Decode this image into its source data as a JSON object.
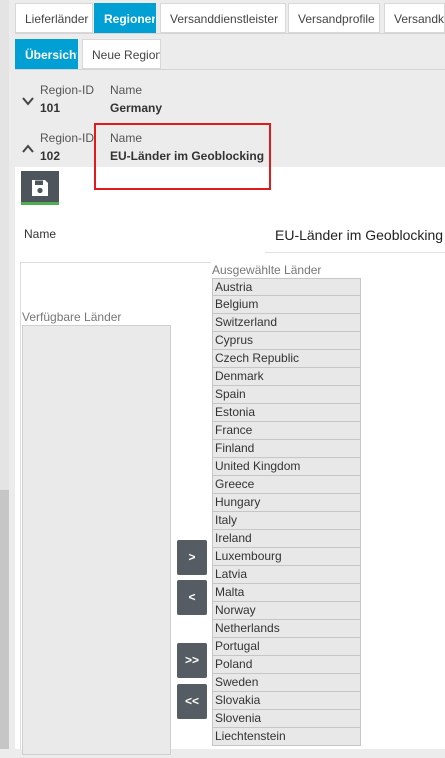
{
  "tabs_top": [
    {
      "label": "Lieferländer"
    },
    {
      "label": "Regionen",
      "active": true
    },
    {
      "label": "Versanddienstleister"
    },
    {
      "label": "Versandprofile"
    },
    {
      "label": "Versandkoste"
    }
  ],
  "tabs_sub": [
    {
      "label": "Übersicht",
      "active": true
    },
    {
      "label": "Neue Region"
    }
  ],
  "regions": [
    {
      "id_label": "Region-ID",
      "id": "101",
      "name_label": "Name",
      "name": "Germany",
      "expanded": false
    },
    {
      "id_label": "Region-ID",
      "id": "102",
      "name_label": "Name",
      "name": "EU-Länder im Geoblocking",
      "expanded": true
    }
  ],
  "form": {
    "name_label": "Name",
    "name_value": "EU-Länder im Geoblocking",
    "available_label": "Verfügbare Länder",
    "selected_label": "Ausgewählte Länder",
    "selected_countries": [
      "Austria",
      "Belgium",
      "Switzerland",
      "Cyprus",
      "Czech Republic",
      "Denmark",
      "Spain",
      "Estonia",
      "France",
      "Finland",
      "United Kingdom",
      "Greece",
      "Hungary",
      "Italy",
      "Ireland",
      "Luxembourg",
      "Latvia",
      "Malta",
      "Norway",
      "Netherlands",
      "Portugal",
      "Poland",
      "Sweden",
      "Slovakia",
      "Slovenia",
      "Liechtenstein"
    ],
    "move_buttons": {
      "add": ">",
      "remove": "<",
      "add_all": ">>",
      "remove_all": "<<"
    }
  },
  "colors": {
    "accent": "#009fd4",
    "highlight": "#e01b1b",
    "save_underline": "#4caf50"
  }
}
